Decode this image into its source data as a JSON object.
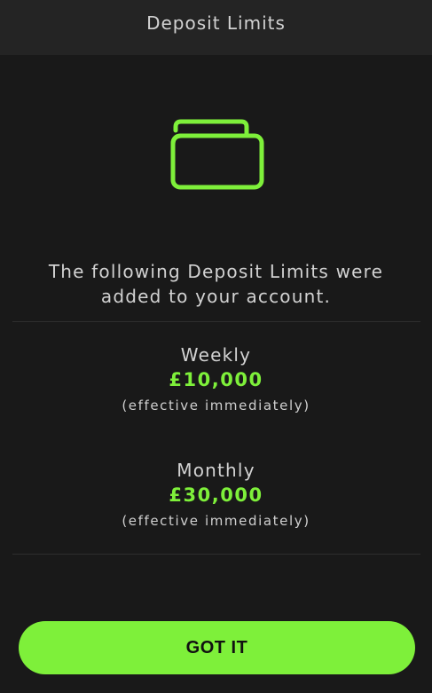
{
  "header": {
    "title": "Deposit Limits"
  },
  "icon": {
    "name": "wallet-icon",
    "color": "#7ef03a"
  },
  "message": {
    "line1": "The following Deposit Limits were",
    "line2": "added to your account."
  },
  "limits": [
    {
      "period": "Weekly",
      "amount": "£10,000",
      "note": "(effective immediately)"
    },
    {
      "period": "Monthly",
      "amount": "£30,000",
      "note": "(effective immediately)"
    }
  ],
  "button": {
    "label": "GOT IT"
  },
  "colors": {
    "background": "#191919",
    "header": "#242424",
    "accent": "#7ef03a",
    "text": "#d2d2d2"
  }
}
